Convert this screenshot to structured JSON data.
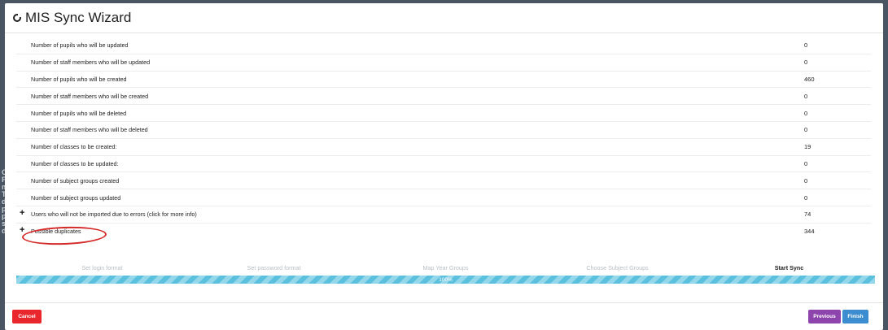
{
  "backdrop": {
    "fragment_text": "C P m T d p p s d"
  },
  "header": {
    "title": "MIS Sync Wizard"
  },
  "stats": [
    {
      "label": "Number of pupils who will be updated",
      "value": "0",
      "expandable": false
    },
    {
      "label": "Number of staff members who will be updated",
      "value": "0",
      "expandable": false
    },
    {
      "label": "Number of pupils who will be created",
      "value": "460",
      "expandable": false
    },
    {
      "label": "Number of staff members who will be created",
      "value": "0",
      "expandable": false
    },
    {
      "label": "Number of pupils who will be deleted",
      "value": "0",
      "expandable": false
    },
    {
      "label": "Number of staff members who will be deleted",
      "value": "0",
      "expandable": false
    },
    {
      "label": "Number of classes to be created:",
      "value": "19",
      "expandable": false
    },
    {
      "label": "Number of classes to be updated:",
      "value": "0",
      "expandable": false
    },
    {
      "label": "Number of subject groups created",
      "value": "0",
      "expandable": false
    },
    {
      "label": "Number of subject groups updated",
      "value": "0",
      "expandable": false
    },
    {
      "label": "Users who will not be imported due to errors (click for more info)",
      "value": "74",
      "expandable": true
    },
    {
      "label": "Possible duplicates",
      "value": "344",
      "expandable": true
    }
  ],
  "expand_symbol": "+",
  "steps": [
    {
      "label": "Set login format",
      "active": false
    },
    {
      "label": "Set password format",
      "active": false
    },
    {
      "label": "Map Year Groups",
      "active": false
    },
    {
      "label": "Choose Subject Groups",
      "active": false
    },
    {
      "label": "Start Sync",
      "active": true
    }
  ],
  "progress": {
    "percent": 100,
    "label": "100%"
  },
  "footer": {
    "cancel_label": "Cancel",
    "previous_label": "Previous",
    "finish_label": "Finish"
  },
  "colors": {
    "cancel": "#e8262c",
    "previous": "#8e44ad",
    "finish": "#3c8dd0",
    "progress": "#5bc0de",
    "annotation": "#d42a2a"
  }
}
